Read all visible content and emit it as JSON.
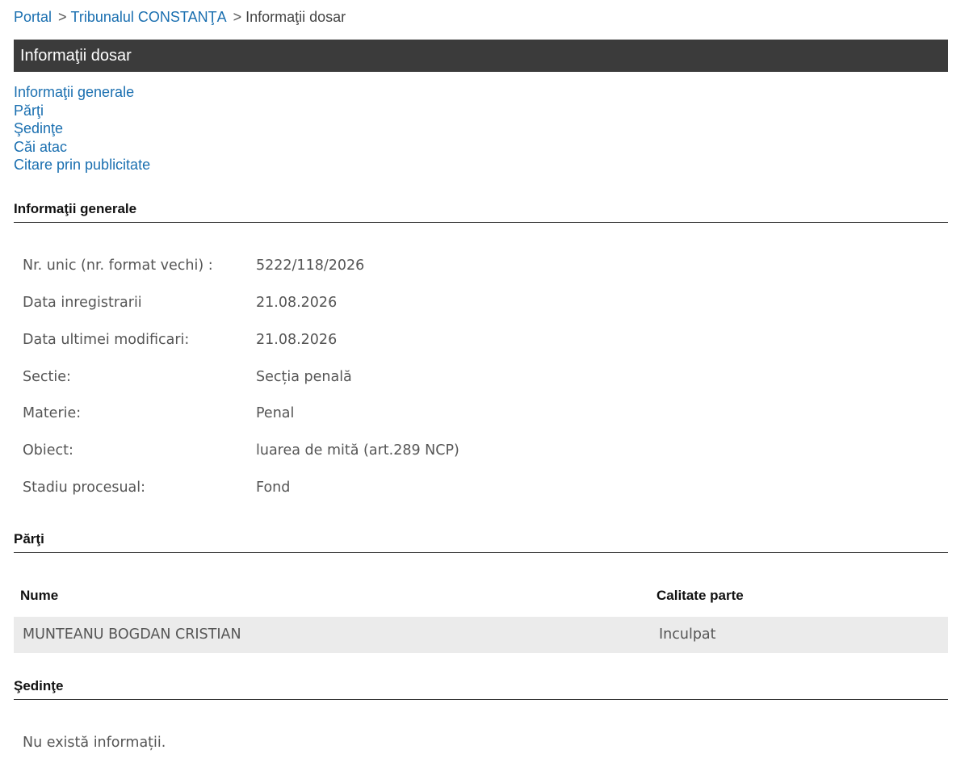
{
  "breadcrumb": {
    "portal": "Portal",
    "separator": ">",
    "court": "Tribunalul CONSTANŢA",
    "current": "Informaţii dosar"
  },
  "title": "Informaţii dosar",
  "anchors": [
    "Informaţii generale",
    "Părţi",
    "Şedinţe",
    "Căi atac",
    "Citare prin publicitate"
  ],
  "general": {
    "heading": "Informaţii generale",
    "rows": [
      {
        "label": "Nr. unic (nr. format vechi) :",
        "value": "5222/118/2026"
      },
      {
        "label": "Data inregistrarii",
        "value": "21.08.2026"
      },
      {
        "label": "Data ultimei modificari:",
        "value": "21.08.2026"
      },
      {
        "label": "Sectie:",
        "value": "Secția penală"
      },
      {
        "label": "Materie:",
        "value": "Penal"
      },
      {
        "label": "Obiect:",
        "value": "luarea de mită (art.289 NCP)"
      },
      {
        "label": "Stadiu procesual:",
        "value": "Fond"
      }
    ]
  },
  "parti": {
    "heading": "Părţi",
    "columns": [
      "Nume",
      "Calitate parte"
    ],
    "rows": [
      [
        "MUNTEANU BOGDAN CRISTIAN",
        "Inculpat"
      ]
    ]
  },
  "sedinte": {
    "heading": "Şedinţe",
    "empty_text": "Nu există informații."
  }
}
